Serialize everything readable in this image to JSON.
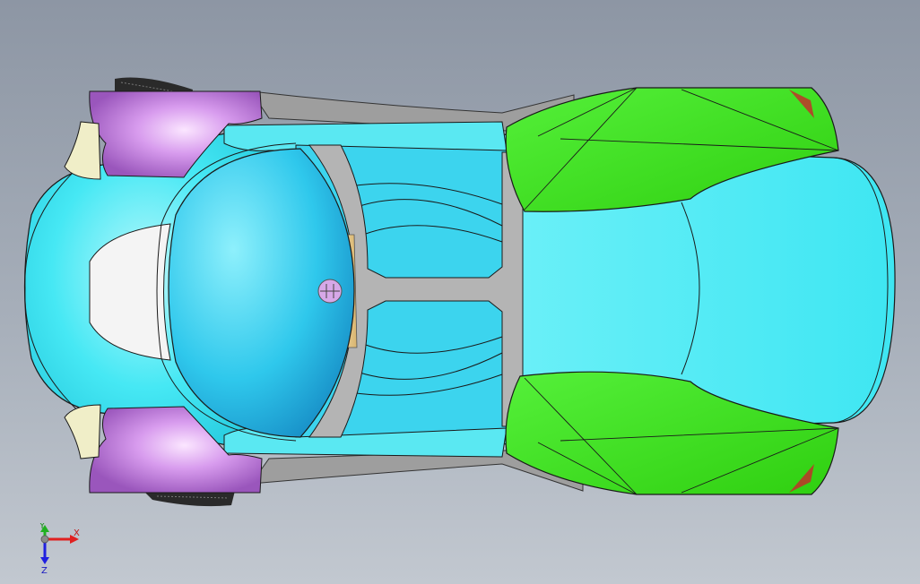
{
  "viewport": {
    "background_top": "#8d96a4",
    "background_bottom": "#c2c8d0"
  },
  "model": {
    "colors": {
      "body": "#38e6f2",
      "body_light": "#aef6fb",
      "canopy": "#42d6f4",
      "fender": "#3fe51a",
      "wheel_arch": "#c77fe0",
      "frame": "#b4b4b4",
      "inner_white": "#f4f4f4",
      "tan": "#e8cc8e",
      "tire": "#2a2a2a",
      "logo": "#d6a8e8"
    },
    "icons": [
      "gear-tire-icon",
      "emblem-icon"
    ]
  },
  "triad": {
    "x_label": "X",
    "y_label": "Y",
    "z_label": "Z",
    "x_color": "#e02020",
    "y_color": "#20b020",
    "z_color": "#2020e0"
  }
}
